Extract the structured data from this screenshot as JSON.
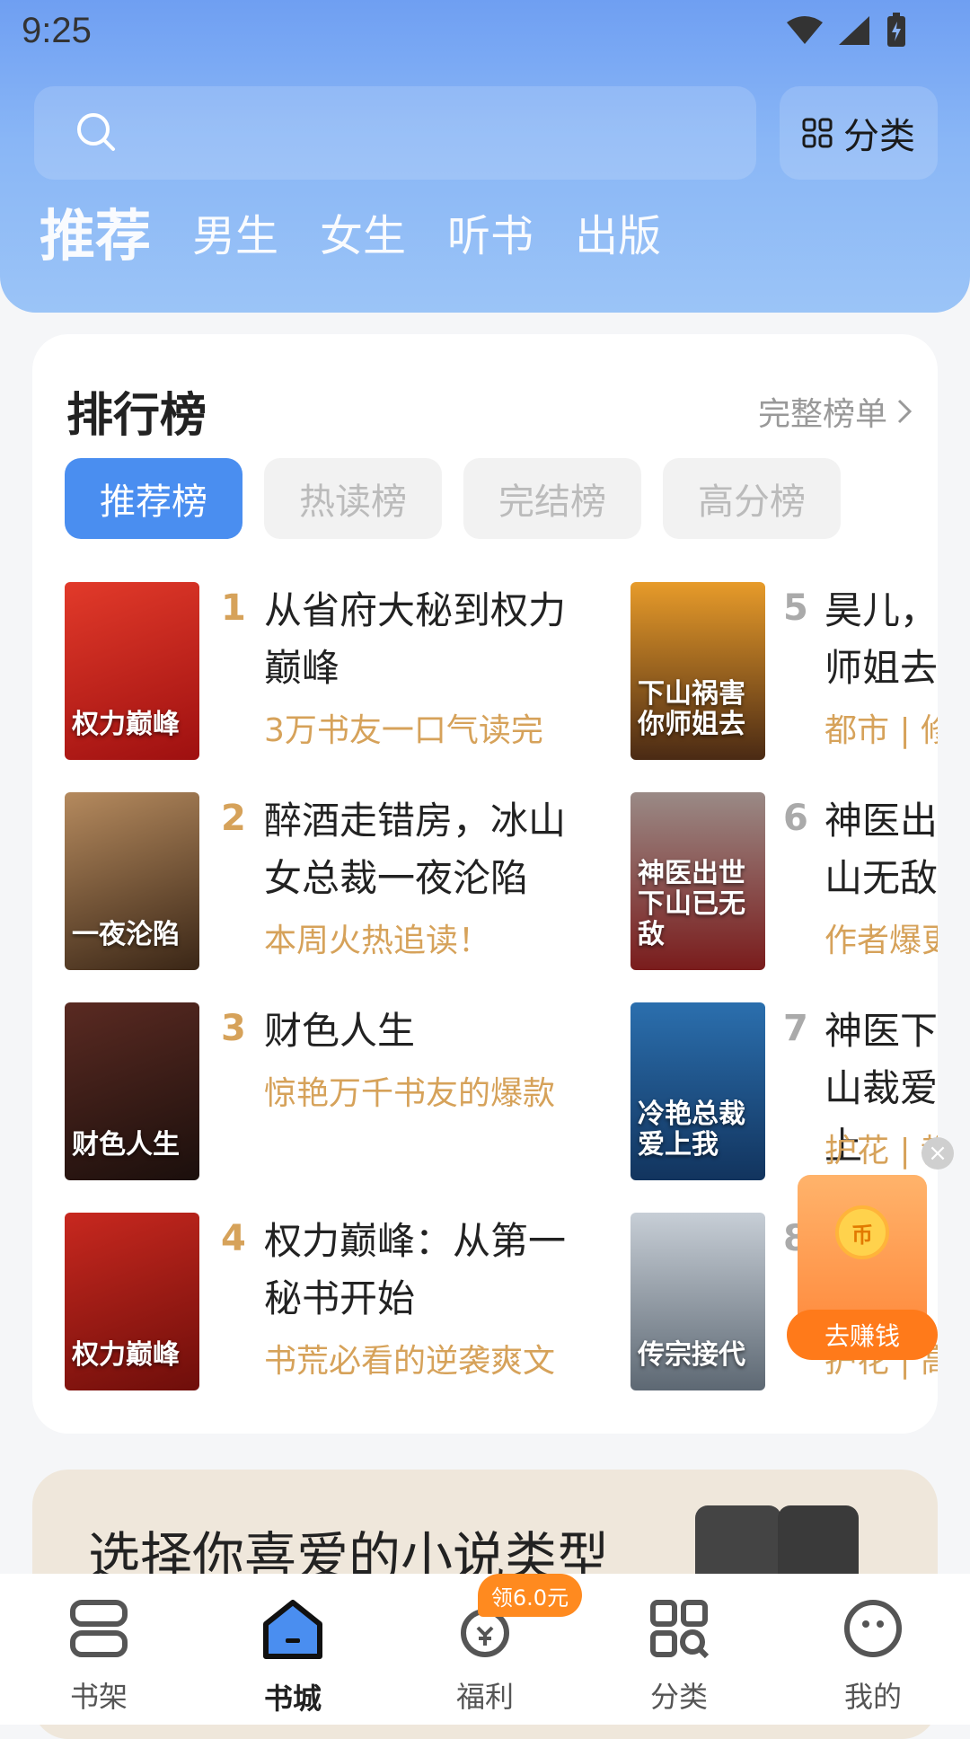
{
  "status_bar": {
    "time": "9:25"
  },
  "search": {
    "placeholder": ""
  },
  "category_button": {
    "label": "分类"
  },
  "tabs": [
    {
      "label": "推荐",
      "active": true
    },
    {
      "label": "男生"
    },
    {
      "label": "女生"
    },
    {
      "label": "听书"
    },
    {
      "label": "出版"
    }
  ],
  "ranking": {
    "title": "排行榜",
    "full_list": "完整榜单",
    "chips": [
      "推荐榜",
      "热读榜",
      "完结榜",
      "高分榜"
    ],
    "books": [
      {
        "rank": "1",
        "title": "从省府大秘到权力巅峰",
        "subtitle": "3万书友一口气读完",
        "cover_text": "权力巅峰",
        "cover_color": "#c81f1f"
      },
      {
        "rank": "2",
        "title": "醉酒走错房，冰山女总裁一夜沦陷",
        "subtitle": "本周火热追读！",
        "cover_text": "一夜沦陷",
        "cover_color": "#6b4a2c"
      },
      {
        "rank": "3",
        "title": "财色人生",
        "subtitle": "惊艳万千书友的爆款",
        "cover_text": "财色人生",
        "cover_color": "#2a1a18"
      },
      {
        "rank": "4",
        "title": "权力巅峰：从第一秘书开始",
        "subtitle": "书荒必看的逆袭爽文",
        "cover_text": "权力巅峰",
        "cover_color": "#a81616"
      },
      {
        "rank": "5",
        "title": "昊儿，师姐去",
        "subtitle": "都市 | 修",
        "cover_text": "下山祸害你师姐去",
        "cover_color": "#3d2a18"
      },
      {
        "rank": "6",
        "title": "神医出山无敌",
        "subtitle": "作者爆更",
        "cover_text": "神医出世下山已无敌",
        "cover_color": "#8a2a2a"
      },
      {
        "rank": "7",
        "title": "神医下山裁爱上",
        "subtitle": "护花 | 都",
        "cover_text": "冷艳总裁爱上我",
        "cover_color": "#1f5e9a"
      },
      {
        "rank": "8",
        "title": "",
        "subtitle": "护花 | 高",
        "cover_text": "传宗接代",
        "cover_color": "#9aa4ae"
      }
    ]
  },
  "floating_reward": {
    "label": "去赚钱",
    "coin": "币"
  },
  "bottom_banner": {
    "title": "选择你喜爱的小说类型"
  },
  "nav": [
    {
      "label": "书架"
    },
    {
      "label": "书城",
      "active": true
    },
    {
      "label": "福利",
      "badge": "领6.0元"
    },
    {
      "label": "分类"
    },
    {
      "label": "我的"
    }
  ]
}
